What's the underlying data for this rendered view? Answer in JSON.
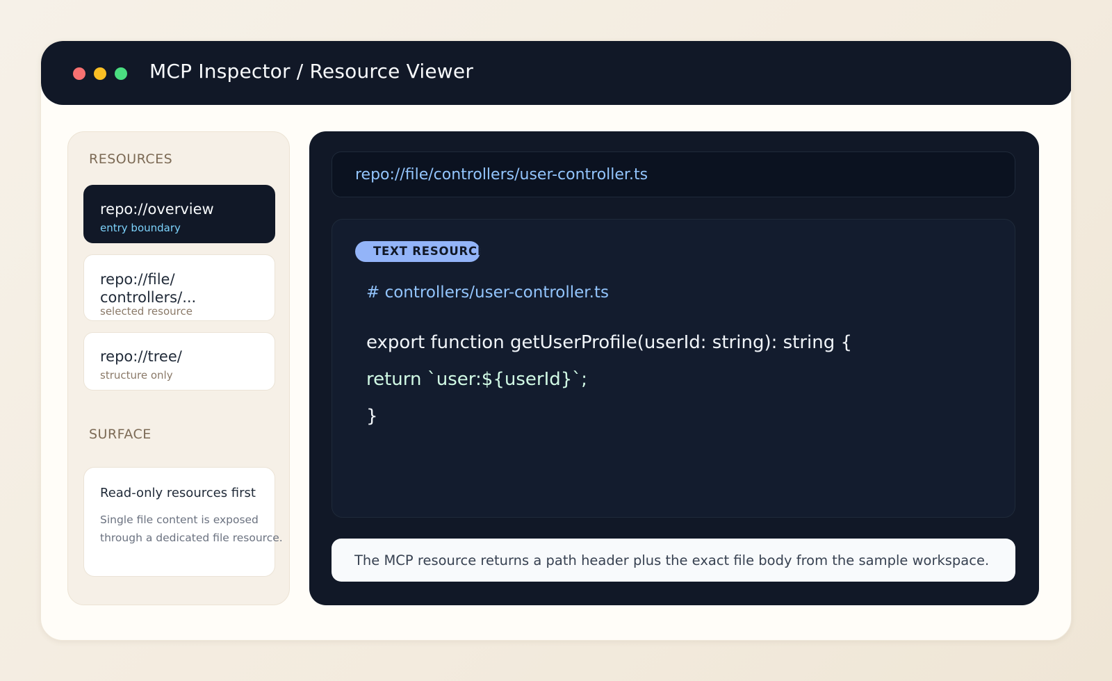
{
  "window": {
    "title": "MCP Inspector / Resource Viewer",
    "controls": [
      "close",
      "minimize",
      "maximize"
    ]
  },
  "sidebar": {
    "resources_label": "RESOURCES",
    "items": [
      {
        "title": "repo://overview",
        "subtitle": "entry boundary",
        "active": true
      },
      {
        "title": "repo://file/",
        "title_line2": "controllers/...",
        "subtitle": "selected resource",
        "active": false
      },
      {
        "title": "repo://tree/",
        "subtitle": "structure only",
        "active": false
      }
    ],
    "surface_label": "SURFACE",
    "surface_card": {
      "title": "Read-only resources first",
      "desc_line1": "Single file content is exposed",
      "desc_line2": "through a dedicated file resource."
    }
  },
  "viewer": {
    "uri": "repo://file/controllers/user-controller.ts",
    "badge": "TEXT RESOURCE",
    "code": {
      "comment": "# controllers/user-controller.ts",
      "line1": "export function getUserProfile(userId: string): string {",
      "line2": "return `user:${userId}`;",
      "line3": "}"
    },
    "footer_note": "The MCP resource returns a path header plus the exact file body from the sample workspace."
  },
  "colors": {
    "dark": "#111827",
    "accent_blue": "#93c5fd",
    "badge": "#93b4f8",
    "dot_red": "#f87171",
    "dot_yellow": "#fbbf24",
    "dot_green": "#4ade80"
  }
}
